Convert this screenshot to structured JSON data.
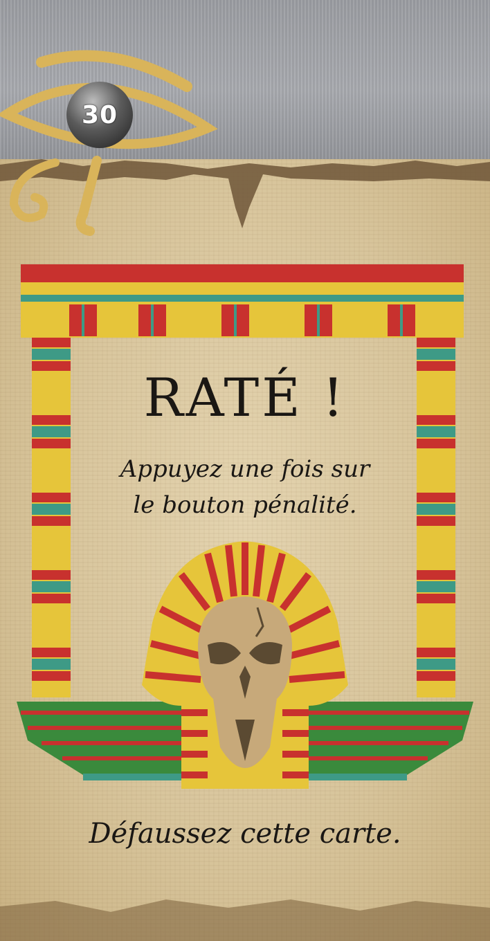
{
  "card": {
    "number": "30",
    "title": "RATÉ !",
    "instruction_line1": "Appuyez une fois sur",
    "instruction_line2": "le bouton pénalité.",
    "footer": "Défaussez cette carte."
  },
  "icons": {
    "eye": "eye-of-horus-icon",
    "pharaoh": "pharaoh-skull-icon"
  },
  "colors": {
    "red": "#c8312e",
    "yellow": "#e6c53a",
    "teal": "#3e9a86",
    "green": "#3a8a3c",
    "gold": "#d9b45a",
    "bone": "#c7a97a",
    "ink": "#1a1714"
  }
}
